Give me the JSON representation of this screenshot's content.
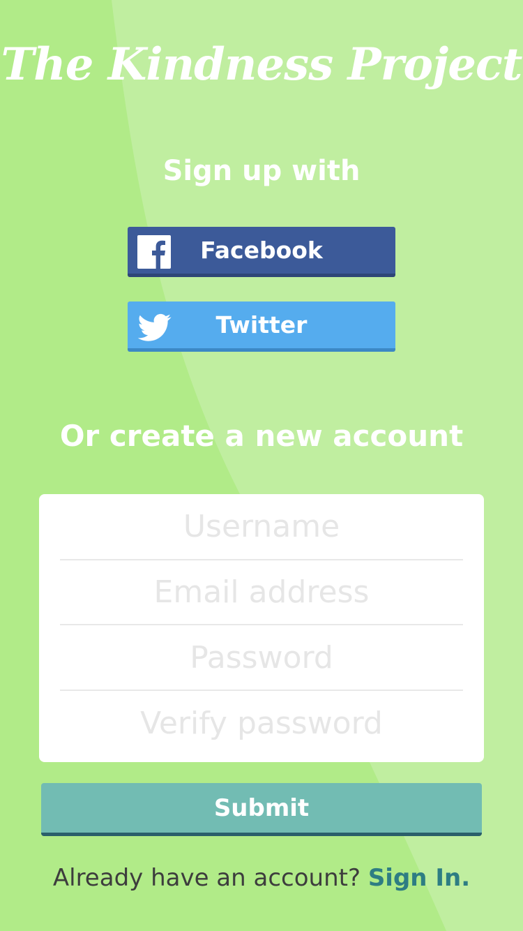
{
  "app": {
    "title": "The Kindness Project"
  },
  "signup": {
    "heading": "Sign up with"
  },
  "social": {
    "facebook_label": "Facebook",
    "twitter_label": "Twitter",
    "facebook_icon": "facebook-icon",
    "twitter_icon": "twitter-icon"
  },
  "create": {
    "heading": "Or create a new account"
  },
  "form": {
    "username_placeholder": "Username",
    "email_placeholder": "Email address",
    "password_placeholder": "Password",
    "verify_placeholder": "Verify password",
    "username_value": "",
    "email_value": "",
    "password_value": "",
    "verify_value": "",
    "submit_label": "Submit"
  },
  "footer": {
    "prompt": "Already have an account?",
    "signin_label": "Sign In."
  },
  "colors": {
    "background": "#b1eb88",
    "background_light": "#c0eea0",
    "facebook": "#3c5a99",
    "twitter": "#55acee",
    "submit": "#72bcb3",
    "link": "#2e7d83"
  }
}
